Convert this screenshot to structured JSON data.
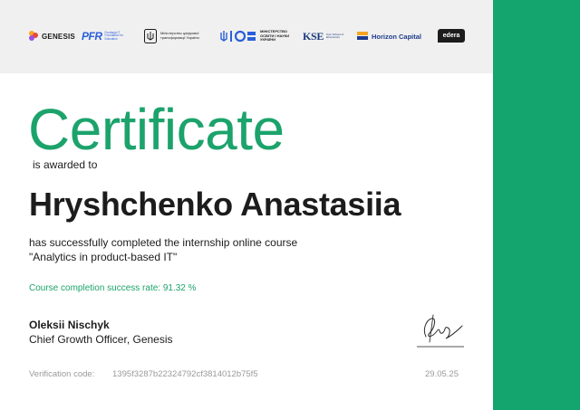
{
  "colors": {
    "brand_green": "#1ca36c",
    "sidebar_green": "#14a46e",
    "text": "#1c1c1c",
    "muted": "#9a9a9a",
    "logo_strip_bg": "#f0f0f0"
  },
  "logos": {
    "genesis": {
      "name": "GENESIS",
      "icon": "genesis-flower-icon"
    },
    "pfr": {
      "mark": "PFR",
      "tagline": "Fundacja IT Foundation for Education"
    },
    "mdt": {
      "icon": "ukraine-trident-icon",
      "text": "Міністерство цифрової трансформації України"
    },
    "mon": {
      "icon": "mon-trident-icon",
      "text": "МІНІСТЕРСТВО ОСВІТИ І НАУКИ УКРАЇНИ"
    },
    "kse": {
      "mark": "KSE",
      "tagline": "Kyiv School of Economics"
    },
    "horizon": {
      "name": "Horizon Capital",
      "icon": "horizon-capital-icon"
    },
    "edera": {
      "name": "edera"
    }
  },
  "certificate": {
    "title": "Certificate",
    "awarded_text": "is awarded to",
    "recipient": "Hryshchenko Anastasiia",
    "completion_line_1": "has successfully completed the internship online course",
    "completion_line_2": "\"Analytics in product-based IT\"",
    "success_rate": "Course completion success rate: 91.32 %",
    "signer_name": "Oleksii Nischyk",
    "signer_role": "Chief Growth Officer, Genesis",
    "verification_label": "Verification code:",
    "verification_code": "1395f3287b22324792cf3814012b75f5",
    "date": "29.05.25"
  }
}
